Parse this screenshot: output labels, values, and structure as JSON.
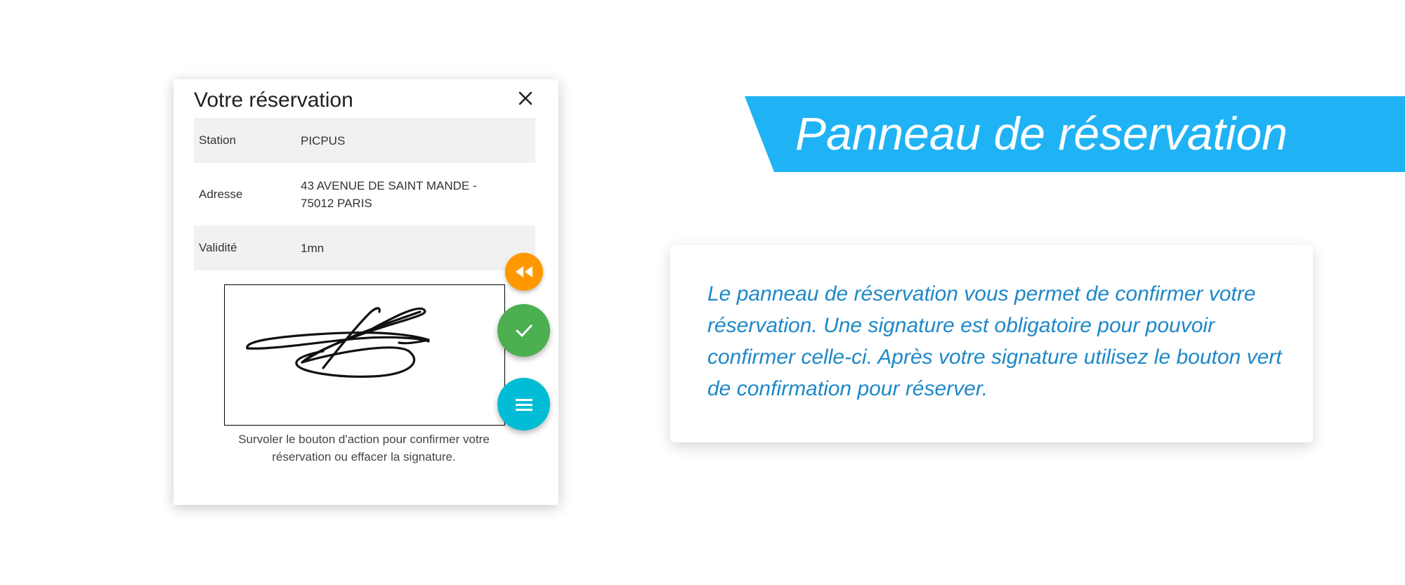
{
  "reservation_panel": {
    "title": "Votre réservation",
    "close_icon": "close-icon",
    "rows": [
      {
        "label": "Station",
        "value": "PICPUS"
      },
      {
        "label": "Adresse",
        "value_line1": "43 AVENUE DE SAINT MANDE -",
        "value_line2": "75012 PARIS"
      },
      {
        "label": "Validité",
        "value": "1mn"
      }
    ],
    "signature_hint_line1": "Survoler le bouton d'action pour confirmer votre",
    "signature_hint_line2": "réservation ou effacer la signature."
  },
  "fab_buttons": [
    {
      "icon": "rewind-icon",
      "color": "#ff9800"
    },
    {
      "icon": "check-icon",
      "color": "#4caf50"
    },
    {
      "icon": "menu-icon",
      "color": "#00bcd4"
    }
  ],
  "banner": {
    "title": "Panneau de réservation",
    "color": "#1fb3f5"
  },
  "description": {
    "text": "Le panneau de réservation vous permet de confirmer votre réservation. Une signature est obligatoire pour pouvoir confirmer celle-ci. Après votre signature utilisez le bouton vert de confirmation pour réserver.",
    "color": "#1e88c8"
  }
}
